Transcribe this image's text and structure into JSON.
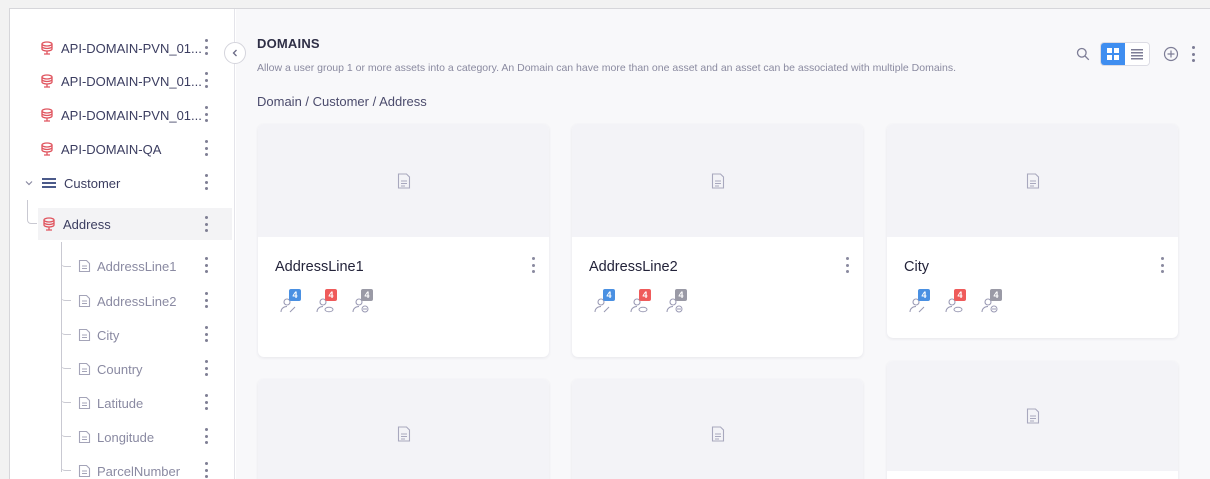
{
  "sidebar": {
    "items": [
      {
        "label": "API-DOMAIN-PVN_01..."
      },
      {
        "label": "API-DOMAIN-PVN_01..."
      },
      {
        "label": "API-DOMAIN-PVN_01..."
      },
      {
        "label": "API-DOMAIN-QA"
      },
      {
        "label": "Customer"
      },
      {
        "label": "Address"
      },
      {
        "label": "AddressLine1"
      },
      {
        "label": "AddressLine2"
      },
      {
        "label": "City"
      },
      {
        "label": "Country"
      },
      {
        "label": "Latitude"
      },
      {
        "label": "Longitude"
      },
      {
        "label": "ParcelNumber"
      }
    ]
  },
  "header": {
    "title": "DOMAINS",
    "subtitle": "Allow a user group 1 or more assets into a category. An Domain can have more than one asset and an asset can be associated with multiple Domains.",
    "breadcrumb": "Domain / Customer / Address"
  },
  "toolbar": {
    "icons": [
      "search-icon",
      "grid-view-icon",
      "list-view-icon",
      "add-circle-icon",
      "more-vertical-icon"
    ]
  },
  "cards": [
    {
      "name": "AddressLine1",
      "badges": [
        "4",
        "4",
        "4"
      ]
    },
    {
      "name": "AddressLine2",
      "badges": [
        "4",
        "4",
        "4"
      ]
    },
    {
      "name": "City",
      "badges": [
        "4",
        "4",
        "4"
      ]
    }
  ],
  "colors": {
    "accent": "#3f8ef0",
    "db_icon": "#e0555f",
    "badge_blue": "#4a90e2",
    "badge_red": "#ef5b5b",
    "badge_gray": "#9a9aa6"
  }
}
